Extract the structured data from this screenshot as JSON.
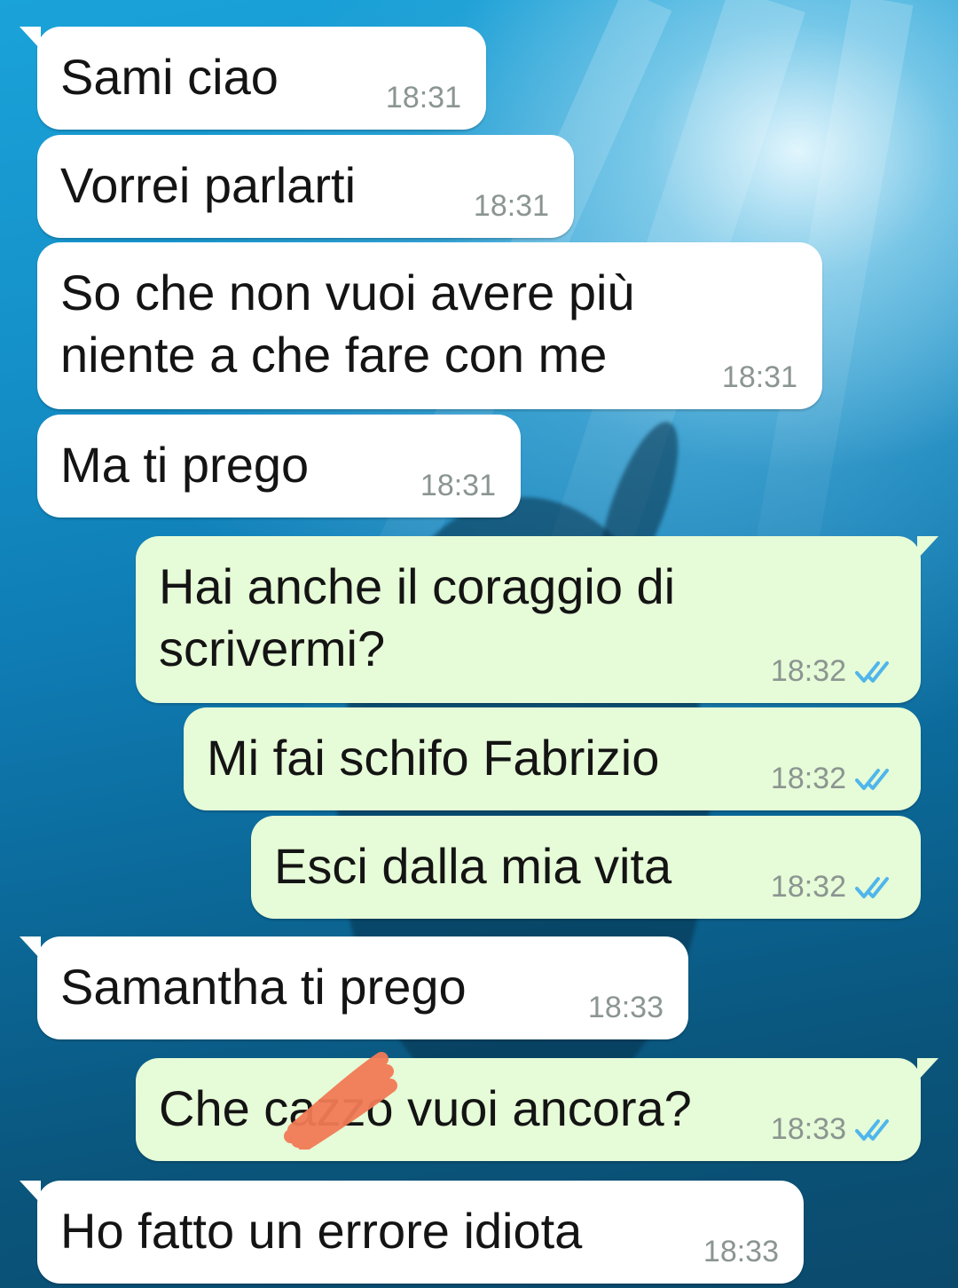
{
  "colors": {
    "incoming_bubble": "#ffffff",
    "outgoing_bubble": "#e6fbd7",
    "read_ticks": "#4fb6ec",
    "timestamp": "#8b9591",
    "redaction_scribble": "#f07a55"
  },
  "messages": [
    {
      "direction": "in",
      "text": "Sami ciao",
      "time": "18:31",
      "tail": true
    },
    {
      "direction": "in",
      "text": "Vorrei parlarti",
      "time": "18:31",
      "tail": false
    },
    {
      "direction": "in",
      "text": "So che non vuoi avere più\nniente a che fare con me",
      "time": "18:31",
      "tail": false
    },
    {
      "direction": "in",
      "text": "Ma ti prego",
      "time": "18:31",
      "tail": false
    },
    {
      "direction": "out",
      "text": "Hai anche il coraggio di\nscrivermi?",
      "time": "18:32",
      "status": "read",
      "tail": true
    },
    {
      "direction": "out",
      "text": "Mi fai schifo Fabrizio",
      "time": "18:32",
      "status": "read",
      "tail": false
    },
    {
      "direction": "out",
      "text": "Esci dalla mia vita",
      "time": "18:32",
      "status": "read",
      "tail": false
    },
    {
      "direction": "in",
      "text": "Samantha ti prego",
      "time": "18:33",
      "tail": true
    },
    {
      "direction": "out",
      "text": "Che cazzo vuoi ancora?",
      "time": "18:33",
      "status": "read",
      "tail": true
    },
    {
      "direction": "in",
      "text": "Ho fatto un errore idiota",
      "time": "18:33",
      "tail": true
    }
  ]
}
